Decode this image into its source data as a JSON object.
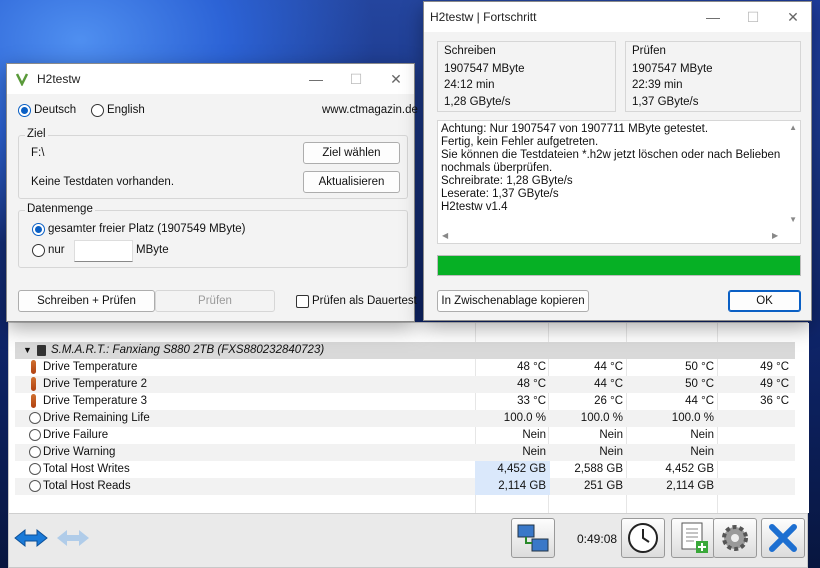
{
  "hw": {
    "smart_title": "S.M.A.R.T.: Fanxiang S880 2TB (FXS880232840723)",
    "rows": [
      {
        "label": "Drive Temperature",
        "icon": "thermometer-icon",
        "c1": "48 °C",
        "c2": "44 °C",
        "c3": "50 °C",
        "c4": "49 °C"
      },
      {
        "label": "Drive Temperature 2",
        "icon": "thermometer-icon",
        "c1": "48 °C",
        "c2": "44 °C",
        "c3": "50 °C",
        "c4": "49 °C"
      },
      {
        "label": "Drive Temperature 3",
        "icon": "thermometer-icon",
        "c1": "33 °C",
        "c2": "26 °C",
        "c3": "44 °C",
        "c4": "36 °C"
      },
      {
        "label": "Drive Remaining Life",
        "icon": "gauge-icon",
        "c1": "100.0 %",
        "c2": "100.0 %",
        "c3": "100.0 %",
        "c4": ""
      },
      {
        "label": "Drive Failure",
        "icon": "gauge-icon",
        "c1": "Nein",
        "c2": "Nein",
        "c3": "Nein",
        "c4": ""
      },
      {
        "label": "Drive Warning",
        "icon": "gauge-icon",
        "c1": "Nein",
        "c2": "Nein",
        "c3": "Nein",
        "c4": ""
      },
      {
        "label": "Total Host Writes",
        "icon": "gauge-icon",
        "c1": "4,452 GB",
        "c2": "2,588 GB",
        "c3": "4,452 GB",
        "c4": ""
      },
      {
        "label": "Total Host Reads",
        "icon": "gauge-icon",
        "c1": "2,114 GB",
        "c2": "251 GB",
        "c3": "2,114 GB",
        "c4": ""
      }
    ],
    "timer": "0:49:08"
  },
  "h2": {
    "title": "H2testw",
    "lang_de": "Deutsch",
    "lang_en": "English",
    "url": "www.ctmagazin.de",
    "ziel_label": "Ziel",
    "ziel_path": "F:\\",
    "ziel_btn": "Ziel wählen",
    "no_data": "Keine Testdaten vorhanden.",
    "refresh_btn": "Aktualisieren",
    "datenmenge_label": "Datenmenge",
    "opt_all": "gesamter freier Platz (1907549 MByte)",
    "opt_only": "nur",
    "mbyte": "MByte",
    "write_btn": "Schreiben + Prüfen",
    "verify_btn": "Prüfen",
    "endless": "Prüfen als Dauertest"
  },
  "prog": {
    "title": "H2testw | Fortschritt",
    "write_label": "Schreiben",
    "write_mb": "1907547 MByte",
    "write_time": "24:12 min",
    "write_rate": "1,28 GByte/s",
    "verify_label": "Prüfen",
    "verify_mb": "1907547 MByte",
    "verify_time": "22:39 min",
    "verify_rate": "1,37 GByte/s",
    "log": [
      "Achtung: Nur 1907547 von 1907711 MByte getestet.",
      "Fertig, kein Fehler aufgetreten.",
      "Sie können die Testdateien *.h2w jetzt löschen oder nach Belieben",
      "nochmals überprüfen.",
      "Schreibrate: 1,28 GByte/s",
      "Leserate: 1,37 GByte/s",
      "H2testw v1.4"
    ],
    "progress": 1.0,
    "progress_color": "#06b025",
    "copy_btn": "In Zwischenablage kopieren",
    "ok_btn": "OK"
  }
}
